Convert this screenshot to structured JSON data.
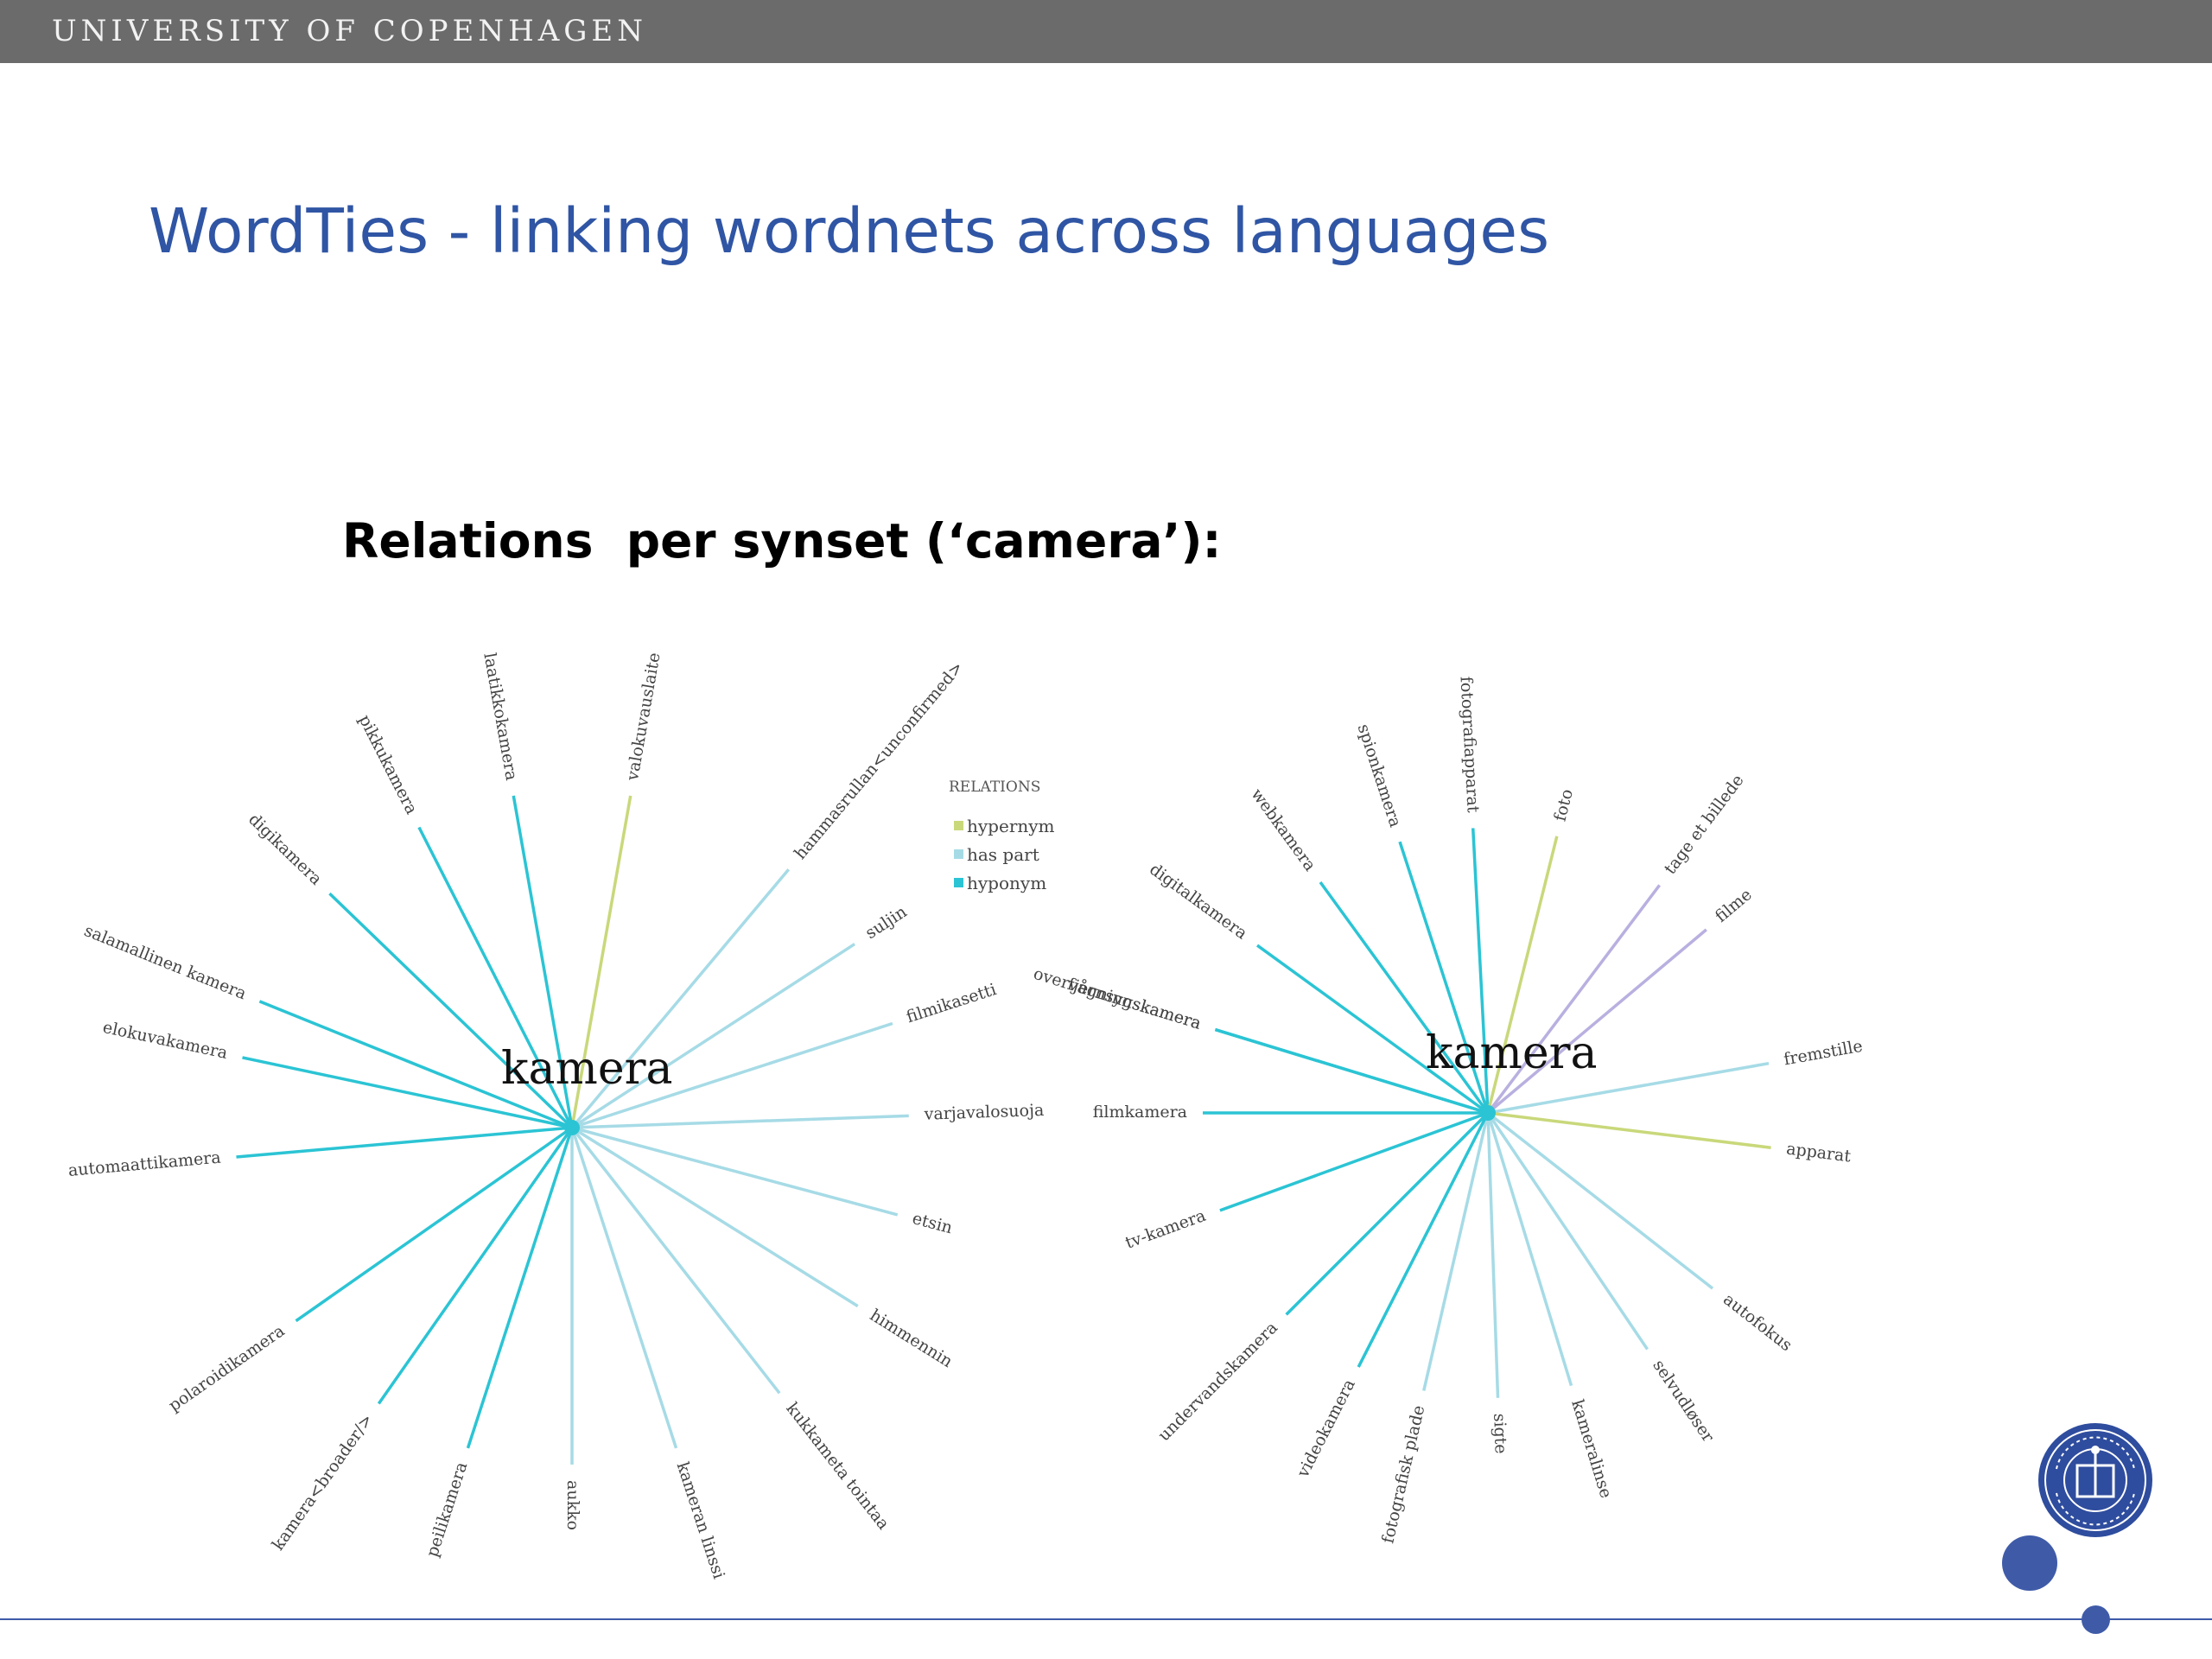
{
  "header": {
    "institution": "UNIVERSITY OF COPENHAGEN"
  },
  "slide": {
    "title": "WordTies - linking wordnets across languages",
    "subtitle": "Relations  per synset (‘camera’):"
  },
  "legend": {
    "heading": "RELATIONS",
    "items": [
      {
        "label": "hypernym",
        "color": "#c9d87a"
      },
      {
        "label": "has part",
        "color": "#a6dbe6"
      },
      {
        "label": "hyponym",
        "color": "#2bc4d4"
      }
    ]
  },
  "graphs": [
    {
      "center": "kamera",
      "nodes": [
        {
          "label": "salamallinen kamera",
          "relation": "hyponym"
        },
        {
          "label": "digikamera",
          "relation": "hyponym"
        },
        {
          "label": "pikkukamera",
          "relation": "hyponym"
        },
        {
          "label": "laatikkokamera",
          "relation": "hyponym"
        },
        {
          "label": "valokuvauslaite",
          "relation": "hypernym"
        },
        {
          "label": "hammasrullan<unconfirmed>",
          "relation": "has part"
        },
        {
          "label": "suljin",
          "relation": "has part"
        },
        {
          "label": "filmikasetti",
          "relation": "has part"
        },
        {
          "label": "varjavalosuoja",
          "relation": "has part"
        },
        {
          "label": "etsin",
          "relation": "has part"
        },
        {
          "label": "himmennin",
          "relation": "has part"
        },
        {
          "label": "kukkameta tointaa",
          "relation": "has part"
        },
        {
          "label": "kameran linssi",
          "relation": "has part"
        },
        {
          "label": "aukko",
          "relation": "has part"
        },
        {
          "label": "peilikamera",
          "relation": "hyponym"
        },
        {
          "label": "kamera<broader/>",
          "relation": "hyponym"
        },
        {
          "label": "polaroidikamera",
          "relation": "hyponym"
        },
        {
          "label": "automaattikamera",
          "relation": "hyponym"
        },
        {
          "label": "elokuvakamera",
          "relation": "hyponym"
        }
      ]
    },
    {
      "center": "kamera",
      "nodes": [
        {
          "label": "fjernsynskamera",
          "relation": "hyponym"
        },
        {
          "label": "digitalkamera",
          "relation": "hyponym"
        },
        {
          "label": "webkamera",
          "relation": "hyponym"
        },
        {
          "label": "spionkamera",
          "relation": "hyponym"
        },
        {
          "label": "fotografiapparat",
          "relation": "hyponym"
        },
        {
          "label": "foto",
          "relation": "hypernym"
        },
        {
          "label": "tage et billede",
          "relation": "other"
        },
        {
          "label": "filme",
          "relation": "other"
        },
        {
          "label": "fremstille",
          "relation": "has part"
        },
        {
          "label": "apparat",
          "relation": "hypernym"
        },
        {
          "label": "autofokus",
          "relation": "has part"
        },
        {
          "label": "selvudløser",
          "relation": "has part"
        },
        {
          "label": "kameralinse",
          "relation": "has part"
        },
        {
          "label": "sigte",
          "relation": "has part"
        },
        {
          "label": "fotografisk plade",
          "relation": "has part"
        },
        {
          "label": "videokamera",
          "relation": "hyponym"
        },
        {
          "label": "undervandskamera",
          "relation": "hyponym"
        },
        {
          "label": "tv-kamera",
          "relation": "hyponym"
        },
        {
          "label": "filmkamera",
          "relation": "hyponym"
        },
        {
          "label": "overvågningskamera",
          "relation": "hyponym"
        }
      ]
    }
  ],
  "colors": {
    "accent": "#3f5ba8",
    "title": "#2f55a4",
    "hyponym": "#2bc4d4",
    "has part": "#a6dbe6",
    "hypernym": "#c9d87a",
    "other": "#b9b0e0"
  }
}
